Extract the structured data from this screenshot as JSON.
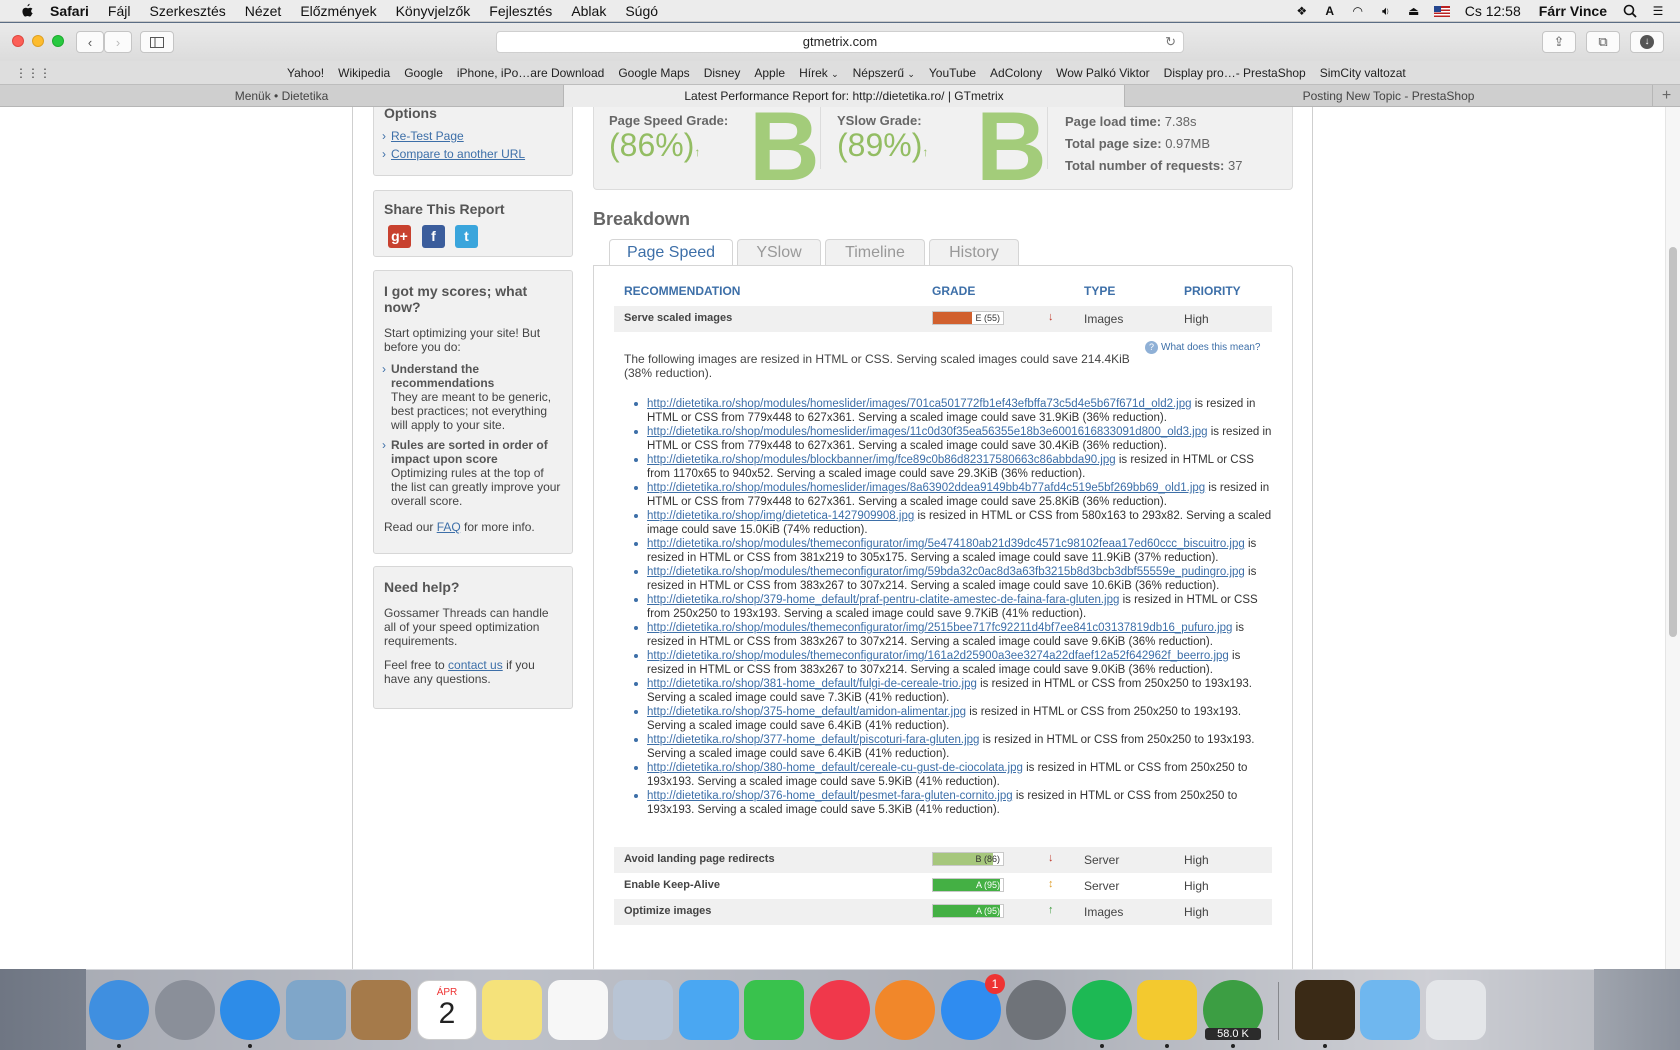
{
  "menubar": {
    "items": [
      "Safari",
      "Fájl",
      "Szerkesztés",
      "Nézet",
      "Előzmények",
      "Könyvjelzők",
      "Fejlesztés",
      "Ablak",
      "Súgó"
    ],
    "clock": "Cs 12:58",
    "user": "Fárr Vince"
  },
  "toolbar": {
    "url": "gtmetrix.com"
  },
  "bookmarks": [
    "Yahoo!",
    "Wikipedia",
    "Google",
    "iPhone, iPo…are Download",
    "Google Maps",
    "Disney",
    "Apple",
    "Hírek",
    "Népszerű",
    "YouTube",
    "AdColony",
    "Wow Palkó Viktor",
    "Display pro…- PrestaShop",
    "SimCity valtozat"
  ],
  "tabs": [
    "Menük • Dietetika",
    "Latest Performance Report for: http://dietetika.ro/ | GTmetrix",
    "Posting New Topic - PrestaShop"
  ],
  "sidebar": {
    "options_title": "Options",
    "options_links": [
      "Re-Test Page",
      "Compare to another URL"
    ],
    "share_title": "Share This Report",
    "scores_title": "I got my scores; what now?",
    "scores_intro": "Start optimizing your site! But before you do:",
    "tip1_title": "Understand the recommendations",
    "tip1_text": "They are meant to be generic, best practices; not everything will apply to your site.",
    "tip2_title": "Rules are sorted in order of impact upon score",
    "tip2_text": "Optimizing rules at the top of the list can greatly improve your overall score.",
    "read_pre": "Read our ",
    "faq": "FAQ",
    "read_post": " for more info.",
    "help_title": "Need help?",
    "help_text": "Gossamer Threads can handle all of your speed optimization requirements.",
    "feel_pre": "Feel free to ",
    "contact": "contact us",
    "feel_post": " if you have any questions."
  },
  "grades": {
    "pagespeed_label": "Page Speed Grade:",
    "pagespeed_pct": "(86%)",
    "pagespeed_letter": "B",
    "yslow_label": "YSlow Grade:",
    "yslow_pct": "(89%)",
    "yslow_letter": "B",
    "load_label": "Page load time:",
    "load_value": "7.38s",
    "size_label": "Total page size:",
    "size_value": "0.97MB",
    "req_label": "Total number of requests:",
    "req_value": "37"
  },
  "breakdown": {
    "title": "Breakdown",
    "tabs": [
      "Page Speed",
      "YSlow",
      "Timeline",
      "History"
    ],
    "headers": [
      "RECOMMENDATION",
      "GRADE",
      "TYPE",
      "PRIORITY"
    ],
    "rows": [
      {
        "name": "Serve scaled images",
        "grade": "E (55)",
        "score": 55,
        "color": "#d1602e",
        "arrow": "↓",
        "arrow_color": "#c0392b",
        "type": "Images",
        "priority": "High"
      },
      {
        "name": "Avoid landing page redirects",
        "grade": "B (86)",
        "score": 86,
        "color": "#a6c77c",
        "arrow": "↓",
        "arrow_color": "#c0392b",
        "type": "Server",
        "priority": "High"
      },
      {
        "name": "Enable Keep-Alive",
        "grade": "A (95)",
        "score": 95,
        "color": "#44b044",
        "arrow": "↕",
        "arrow_color": "#e0a030",
        "type": "Server",
        "priority": "High"
      },
      {
        "name": "Optimize images",
        "grade": "A (95)",
        "score": 95,
        "color": "#44b044",
        "arrow": "↑",
        "arrow_color": "#3a9a3a",
        "type": "Images",
        "priority": "High"
      }
    ],
    "whatis": "What does this mean?",
    "description": "The following images are resized in HTML or CSS. Serving scaled images could save 214.4KiB (38% reduction).",
    "images": [
      {
        "url": "http://dietetika.ro/shop/modules/homeslider/images/701ca501772fb1ef43efbffa73c5d4e5b67f671d_old2.jpg",
        "text": " is resized in HTML or CSS from 779x448 to 627x361. Serving a scaled image could save 31.9KiB (36% reduction)."
      },
      {
        "url": "http://dietetika.ro/shop/modules/homeslider/images/11c0d30f35ea56355e18b3e6001616833091d800_old3.jpg",
        "text": " is resized in HTML or CSS from 779x448 to 627x361. Serving a scaled image could save 30.4KiB (36% reduction)."
      },
      {
        "url": "http://dietetika.ro/shop/modules/blockbanner/img/fce89c0b86d82317580663c86abbda90.jpg",
        "text": " is resized in HTML or CSS from 1170x65 to 940x52. Serving a scaled image could save 29.3KiB (36% reduction)."
      },
      {
        "url": "http://dietetika.ro/shop/modules/homeslider/images/8a63902ddea9149bb4b77afd4c519e5bf269bb69_old1.jpg",
        "text": " is resized in HTML or CSS from 779x448 to 627x361. Serving a scaled image could save 25.8KiB (36% reduction)."
      },
      {
        "url": "http://dietetika.ro/shop/img/dietetica-1427909908.jpg",
        "text": " is resized in HTML or CSS from 580x163 to 293x82. Serving a scaled image could save 15.0KiB (74% reduction)."
      },
      {
        "url": "http://dietetika.ro/shop/modules/themeconfigurator/img/5e474180ab21d39dc4571c98102feaa17ed60ccc_biscuitro.jpg",
        "text": " is resized in HTML or CSS from 381x219 to 305x175. Serving a scaled image could save 11.9KiB (37% reduction)."
      },
      {
        "url": "http://dietetika.ro/shop/modules/themeconfigurator/img/59bda32c0ac8d3a63fb3215b8d3bcb3dbf55559e_pudingro.jpg",
        "text": " is resized in HTML or CSS from 383x267 to 307x214. Serving a scaled image could save 10.6KiB (36% reduction)."
      },
      {
        "url": "http://dietetika.ro/shop/379-home_default/praf-pentru-clatite-amestec-de-faina-fara-gluten.jpg",
        "text": " is resized in HTML or CSS from 250x250 to 193x193. Serving a scaled image could save 9.7KiB (41% reduction)."
      },
      {
        "url": "http://dietetika.ro/shop/modules/themeconfigurator/img/2515bee717fc92211d4bf7ee841c03137819db16_pufuro.jpg",
        "text": " is resized in HTML or CSS from 383x267 to 307x214. Serving a scaled image could save 9.6KiB (36% reduction)."
      },
      {
        "url": "http://dietetika.ro/shop/modules/themeconfigurator/img/161a2d25900a3ee3274a22dfaef12a52f642962f_beerro.jpg",
        "text": " is resized in HTML or CSS from 383x267 to 307x214. Serving a scaled image could save 9.0KiB (36% reduction)."
      },
      {
        "url": "http://dietetika.ro/shop/381-home_default/fulgi-de-cereale-trio.jpg",
        "text": " is resized in HTML or CSS from 250x250 to 193x193. Serving a scaled image could save 7.3KiB (41% reduction)."
      },
      {
        "url": "http://dietetika.ro/shop/375-home_default/amidon-alimentar.jpg",
        "text": " is resized in HTML or CSS from 250x250 to 193x193. Serving a scaled image could save 6.4KiB (41% reduction)."
      },
      {
        "url": "http://dietetika.ro/shop/377-home_default/piscoturi-fara-gluten.jpg",
        "text": " is resized in HTML or CSS from 250x250 to 193x193. Serving a scaled image could save 6.4KiB (41% reduction)."
      },
      {
        "url": "http://dietetika.ro/shop/380-home_default/cereale-cu-gust-de-ciocolata.jpg",
        "text": " is resized in HTML or CSS from 250x250 to 193x193. Serving a scaled image could save 5.9KiB (41% reduction)."
      },
      {
        "url": "http://dietetika.ro/shop/376-home_default/pesmet-fara-gluten-cornito.jpg",
        "text": " is resized in HTML or CSS from 250x250 to 193x193. Serving a scaled image could save 5.3KiB (41% reduction)."
      }
    ]
  },
  "dock": {
    "calendar_month": "ÁPR",
    "calendar_day": "2",
    "appstore_badge": "1",
    "utorrent_badge": "58.0 K",
    "items": [
      {
        "name": "finder-icon",
        "color": "#3f8fe0",
        "dot": true
      },
      {
        "name": "launchpad-icon",
        "color": "#8a8f99",
        "dot": false
      },
      {
        "name": "safari-icon",
        "color": "#2d8ce8",
        "dot": true
      },
      {
        "name": "mail-icon",
        "color": "#7fa6c9",
        "dot": false
      },
      {
        "name": "contacts-icon",
        "color": "#a57a4a",
        "dot": false
      },
      {
        "name": "calendar-icon",
        "color": "#ffffff",
        "dot": false
      },
      {
        "name": "notes-icon",
        "color": "#f5e27a",
        "dot": false
      },
      {
        "name": "reminders-icon",
        "color": "#f7f7f7",
        "dot": false
      },
      {
        "name": "preview-icon",
        "color": "#b8c4d4",
        "dot": false
      },
      {
        "name": "messages-icon",
        "color": "#4aa7f2",
        "dot": false
      },
      {
        "name": "facetime-icon",
        "color": "#39c24d",
        "dot": false
      },
      {
        "name": "itunes-icon",
        "color": "#f0384b",
        "dot": false
      },
      {
        "name": "ibooks-icon",
        "color": "#f1872a",
        "dot": false
      },
      {
        "name": "app-store-icon",
        "color": "#2f8cf0",
        "dot": false
      },
      {
        "name": "system-preferences-icon",
        "color": "#6f7379",
        "dot": false
      },
      {
        "name": "spotify-icon",
        "color": "#1db954",
        "dot": true
      },
      {
        "name": "cyberduck-icon",
        "color": "#f3c92f",
        "dot": true
      },
      {
        "name": "utorrent-icon",
        "color": "#3c9e43",
        "dot": true
      },
      {
        "name": "bridge-icon",
        "color": "#3a2a16",
        "dot": true
      },
      {
        "name": "folder-icon",
        "color": "#6fb7ef",
        "dot": false
      },
      {
        "name": "trash-icon",
        "color": "#e4e6e9",
        "dot": false
      }
    ]
  }
}
